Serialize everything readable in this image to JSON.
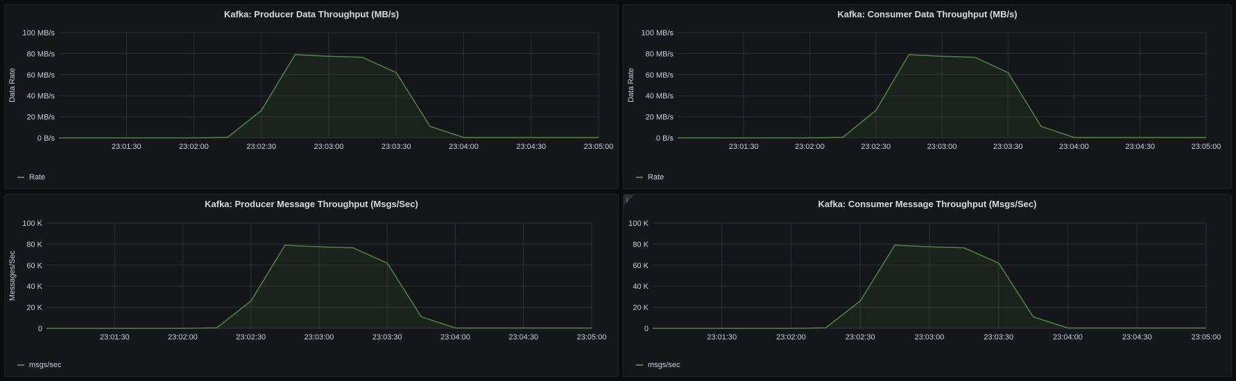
{
  "series_color": "#508642",
  "panels": [
    {
      "title": "Kafka: Producer Data Throughput (MB/s)",
      "ylabel": "Data Rate",
      "legend": "Rate",
      "info_icon": "",
      "chart_data": {
        "type": "area",
        "title": "Kafka: Producer Data Throughput (MB/s)",
        "xlabel": "",
        "ylabel": "Data Rate",
        "x": [
          "23:01:00",
          "23:01:15",
          "23:01:30",
          "23:01:45",
          "23:02:00",
          "23:02:15",
          "23:02:30",
          "23:02:45",
          "23:03:00",
          "23:03:15",
          "23:03:30",
          "23:03:45",
          "23:04:00",
          "23:04:15",
          "23:04:30",
          "23:04:45",
          "23:05:00"
        ],
        "series": [
          {
            "name": "Rate",
            "values": [
              0,
              0,
              0,
              0,
              0,
              0.5,
              26,
              79,
              77.5,
              76.5,
              62,
              11,
              0.3,
              0.3,
              0.3,
              0.3,
              0.3
            ]
          }
        ],
        "ylim": [
          0,
          100
        ],
        "yticks": [
          0,
          20,
          40,
          60,
          80,
          100
        ],
        "ytick_labels": [
          "0 B/s",
          "20 MB/s",
          "40 MB/s",
          "60 MB/s",
          "80 MB/s",
          "100 MB/s"
        ],
        "xtick_labels": [
          "23:01:30",
          "23:02:00",
          "23:02:30",
          "23:03:00",
          "23:03:30",
          "23:04:00",
          "23:04:30",
          "23:05:00"
        ],
        "grid": true,
        "legend_position": "bottom-left"
      }
    },
    {
      "title": "Kafka: Consumer Data Throughput (MB/s)",
      "ylabel": "Data Rate",
      "legend": "Rate",
      "info_icon": "",
      "chart_data": {
        "type": "area",
        "title": "Kafka: Consumer Data Throughput (MB/s)",
        "xlabel": "",
        "ylabel": "Data Rate",
        "x": [
          "23:01:00",
          "23:01:15",
          "23:01:30",
          "23:01:45",
          "23:02:00",
          "23:02:15",
          "23:02:30",
          "23:02:45",
          "23:03:00",
          "23:03:15",
          "23:03:30",
          "23:03:45",
          "23:04:00",
          "23:04:15",
          "23:04:30",
          "23:04:45",
          "23:05:00"
        ],
        "series": [
          {
            "name": "Rate",
            "values": [
              0,
              0,
              0,
              0,
              0,
              0.5,
              26,
              79,
              77.5,
              76.5,
              62,
              11,
              0.3,
              0.3,
              0.3,
              0.3,
              0.3
            ]
          }
        ],
        "ylim": [
          0,
          100
        ],
        "yticks": [
          0,
          20,
          40,
          60,
          80,
          100
        ],
        "ytick_labels": [
          "0 B/s",
          "20 MB/s",
          "40 MB/s",
          "60 MB/s",
          "80 MB/s",
          "100 MB/s"
        ],
        "xtick_labels": [
          "23:01:30",
          "23:02:00",
          "23:02:30",
          "23:03:00",
          "23:03:30",
          "23:04:00",
          "23:04:30",
          "23:05:00"
        ],
        "grid": true,
        "legend_position": "bottom-left"
      }
    },
    {
      "title": "Kafka: Producer Message Throughput (Msgs/Sec)",
      "ylabel": "Messages/Sec",
      "legend": "msgs/sec",
      "info_icon": "",
      "chart_data": {
        "type": "area",
        "title": "Kafka: Producer Message Throughput (Msgs/Sec)",
        "xlabel": "",
        "ylabel": "Messages/Sec",
        "x": [
          "23:01:00",
          "23:01:15",
          "23:01:30",
          "23:01:45",
          "23:02:00",
          "23:02:15",
          "23:02:30",
          "23:02:45",
          "23:03:00",
          "23:03:15",
          "23:03:30",
          "23:03:45",
          "23:04:00",
          "23:04:15",
          "23:04:30",
          "23:04:45",
          "23:05:00"
        ],
        "series": [
          {
            "name": "msgs/sec",
            "values": [
              0,
              0,
              0,
              0,
              0,
              0.5,
              26,
              79,
              77.5,
              76.5,
              62,
              11,
              0.3,
              0.3,
              0.3,
              0.3,
              0.3
            ]
          }
        ],
        "ylim": [
          0,
          100
        ],
        "yticks": [
          0,
          20,
          40,
          60,
          80,
          100
        ],
        "ytick_labels": [
          "0",
          "20 K",
          "40 K",
          "60 K",
          "80 K",
          "100 K"
        ],
        "xtick_labels": [
          "23:01:30",
          "23:02:00",
          "23:02:30",
          "23:03:00",
          "23:03:30",
          "23:04:00",
          "23:04:30",
          "23:05:00"
        ],
        "grid": true,
        "legend_position": "bottom-left"
      }
    },
    {
      "title": "Kafka: Consumer Message Throughput (Msgs/Sec)",
      "ylabel": "",
      "legend": "msgs/sec",
      "info_icon": "i",
      "chart_data": {
        "type": "area",
        "title": "Kafka: Consumer Message Throughput (Msgs/Sec)",
        "xlabel": "",
        "ylabel": "",
        "x": [
          "23:01:00",
          "23:01:15",
          "23:01:30",
          "23:01:45",
          "23:02:00",
          "23:02:15",
          "23:02:30",
          "23:02:45",
          "23:03:00",
          "23:03:15",
          "23:03:30",
          "23:03:45",
          "23:04:00",
          "23:04:15",
          "23:04:30",
          "23:04:45",
          "23:05:00"
        ],
        "series": [
          {
            "name": "msgs/sec",
            "values": [
              0,
              0,
              0,
              0,
              0,
              0.5,
              26,
              79,
              77.5,
              76.5,
              62,
              11,
              0.3,
              0.3,
              0.3,
              0.3,
              0.3
            ]
          }
        ],
        "ylim": [
          0,
          100
        ],
        "yticks": [
          0,
          20,
          40,
          60,
          80,
          100
        ],
        "ytick_labels": [
          "0",
          "20 K",
          "40 K",
          "60 K",
          "80 K",
          "100 K"
        ],
        "xtick_labels": [
          "23:01:30",
          "23:02:00",
          "23:02:30",
          "23:03:00",
          "23:03:30",
          "23:04:00",
          "23:04:30",
          "23:05:00"
        ],
        "grid": true,
        "legend_position": "bottom-left"
      }
    }
  ]
}
